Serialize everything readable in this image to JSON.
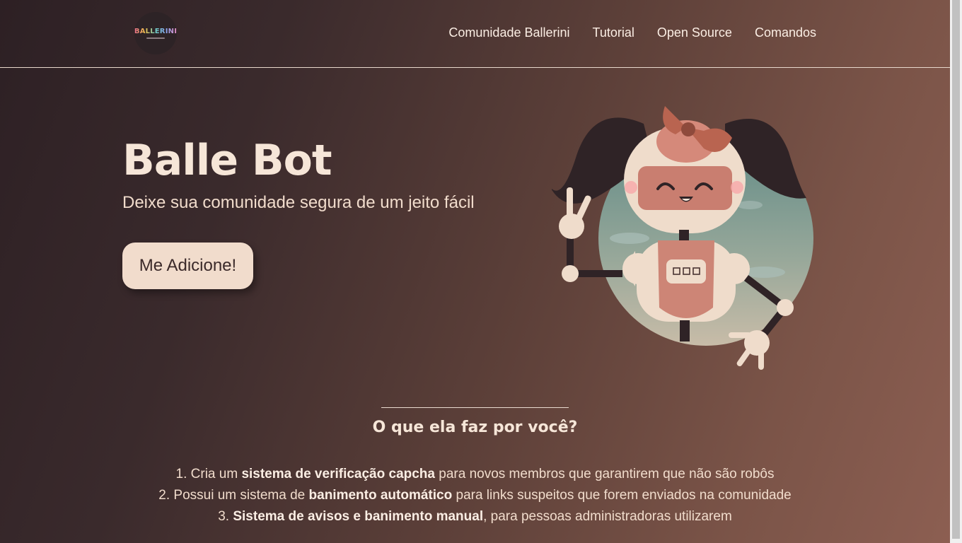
{
  "brand": {
    "logo_text": "BALLERINI"
  },
  "nav": {
    "links": [
      "Comunidade Ballerini",
      "Tutorial",
      "Open Source",
      "Comandos"
    ]
  },
  "hero": {
    "title": "Balle Bot",
    "subtitle": "Deixe sua comunidade segura de um jeito fácil",
    "cta_label": "Me Adicione!"
  },
  "section": {
    "title": "O que ela faz por você?",
    "features": [
      {
        "number": "1.",
        "pre": "Cria um ",
        "bold": "sistema de verificação capcha",
        "post": " para novos membros que garantirem que não são robôs"
      },
      {
        "number": "2.",
        "pre": "Possui um sistema de ",
        "bold": "banimento automático",
        "post": " para links suspeitos que forem enviados na comunidade"
      },
      {
        "number": "3.",
        "pre": "",
        "bold": "Sistema de avisos e banimento manual",
        "post": ", para pessoas administradoras utilizarem"
      }
    ]
  },
  "colors": {
    "background_dark": "#2d2024",
    "background_light": "#8d5f52",
    "button_bg": "#f1dccc",
    "text_light": "#f6e6d8"
  }
}
